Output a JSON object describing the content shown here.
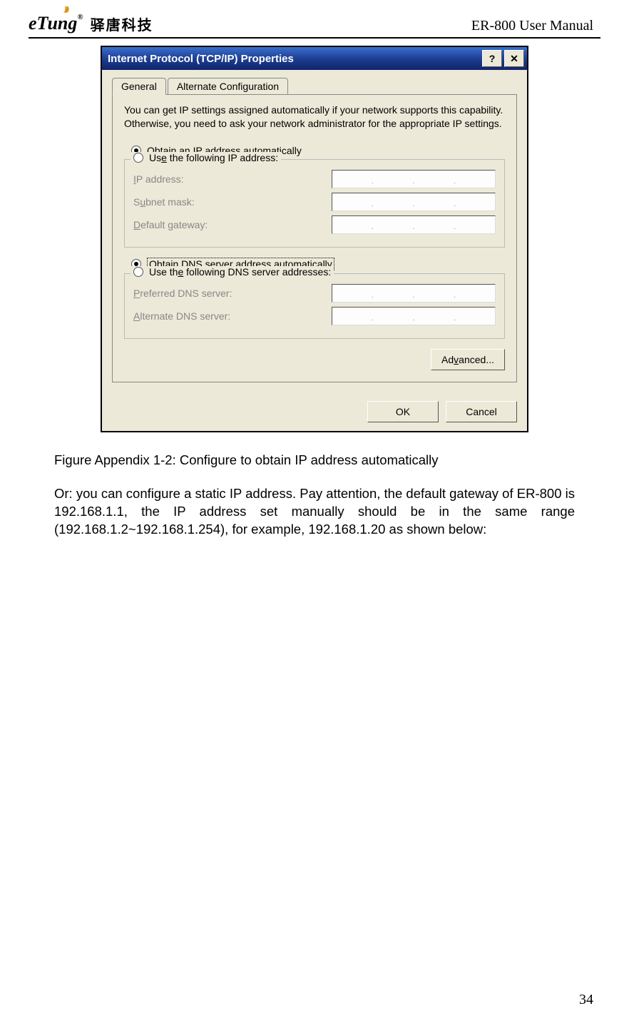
{
  "header": {
    "logo_text": "eTung",
    "logo_reg": "®",
    "logo_cn": "驿唐科技",
    "doc_title": "ER-800 User Manual"
  },
  "dialog": {
    "title": "Internet Protocol (TCP/IP) Properties",
    "help_btn": "?",
    "close_btn": "✕",
    "tabs": {
      "general": "General",
      "alt": "Alternate Configuration"
    },
    "intro": "You can get IP settings assigned automatically if your network supports this capability. Otherwise, you need to ask your network administrator for the appropriate IP settings.",
    "radio_obtain_ip_pre": "O",
    "radio_obtain_ip_rest": "btain an IP address automatically",
    "radio_use_ip_pre": "Us",
    "radio_use_ip_u": "e",
    "radio_use_ip_rest": " the following IP address:",
    "lbl_ip_pre": "I",
    "lbl_ip_rest": "P address:",
    "lbl_subnet_pre": "S",
    "lbl_subnet_u": "u",
    "lbl_subnet_rest": "bnet mask:",
    "lbl_gw_pre": "D",
    "lbl_gw_rest": "efault gateway:",
    "radio_obtain_dns_pre": "O",
    "radio_obtain_dns_u": "b",
    "radio_obtain_dns_rest": "tain DNS server address automatically",
    "radio_use_dns_pre": "Use th",
    "radio_use_dns_u": "e",
    "radio_use_dns_rest": " following DNS server addresses:",
    "lbl_pdns_pre": "P",
    "lbl_pdns_rest": "referred DNS server:",
    "lbl_adns_pre": "A",
    "lbl_adns_rest": "lternate DNS server:",
    "btn_advanced_pre": "Ad",
    "btn_advanced_u": "v",
    "btn_advanced_rest": "anced...",
    "btn_ok": "OK",
    "btn_cancel": "Cancel",
    "dot": "."
  },
  "caption": "Figure Appendix 1-2: Configure to obtain IP address automatically",
  "bodytext": "Or: you can configure a static IP address. Pay attention, the default gateway of ER-800 is 192.168.1.1, the IP address set manually should be in the same range (192.168.1.2~192.168.1.254), for example, 192.168.1.20 as shown below:",
  "pagenum": "34"
}
